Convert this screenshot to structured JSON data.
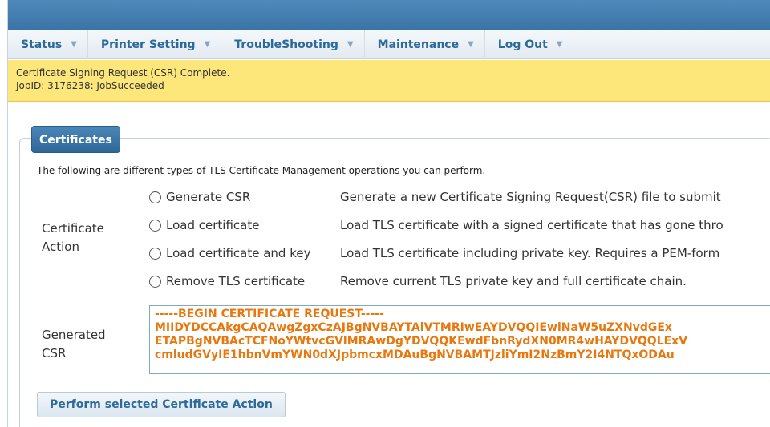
{
  "nav": {
    "items": [
      {
        "label": "Status"
      },
      {
        "label": "Printer Setting"
      },
      {
        "label": "TroubleShooting"
      },
      {
        "label": "Maintenance"
      },
      {
        "label": "Log Out"
      }
    ],
    "caret_icon": "chevron-down-icon"
  },
  "banner": {
    "line1": "Certificate Signing Request (CSR) Complete.",
    "line2": "JobID: 3176238: JobSucceeded",
    "color": "#fde67a"
  },
  "certificates": {
    "legend": "Certificates",
    "intro": "The following are different types of TLS Certificate Management operations you can perform.",
    "action_label_1": "Certificate",
    "action_label_2": "Action",
    "options": [
      {
        "label": "Generate CSR",
        "desc": "Generate a new Certificate Signing Request(CSR) file to submit"
      },
      {
        "label": "Load certificate",
        "desc": "Load TLS certificate with a signed certificate that has gone thro"
      },
      {
        "label": "Load certificate and key",
        "desc": "Load TLS certificate including private key. Requires a PEM-form"
      },
      {
        "label": "Remove TLS certificate",
        "desc": "Remove current TLS private key and full certificate chain."
      }
    ],
    "csr_label_1": "Generated",
    "csr_label_2": "CSR",
    "csr_lines": [
      "-----BEGIN CERTIFICATE REQUEST-----",
      "MIIDYDCCAkgCAQAwgZgxCzAJBgNVBAYTAlVTMRIwEAYDVQQIEwlNaW5uZXNvdGEx",
      "ETAPBgNVBAcTCFNoYWtvcGVlMRAwDgYDVQQKEwdFbnRydXN0MR4wHAYDVQQLExV",
      "cmludGVyIE1hbnVmYWN0dXJpbmcxMDAuBgNVBAMTJzliYmI2NzBmY2I4NTQxODAu"
    ],
    "csr_color": "#e8780e",
    "perform_button": "Perform selected Certificate Action"
  }
}
